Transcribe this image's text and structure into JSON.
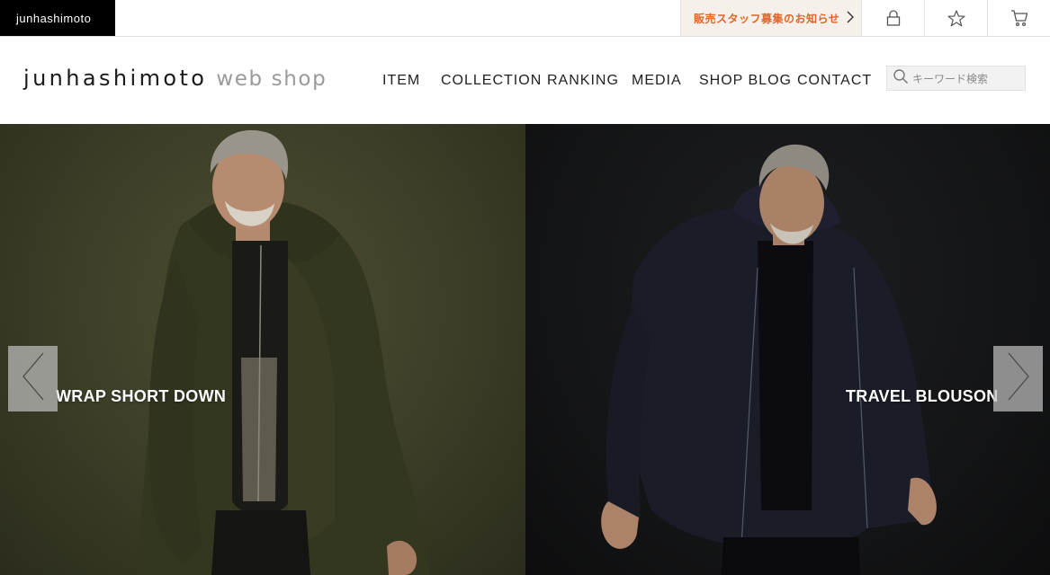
{
  "topbar": {
    "brand": "junhashimoto",
    "recruit": "販売スタッフ募集のお知らせ",
    "icons": [
      "chevron-right-icon",
      "lock-icon",
      "star-icon",
      "cart-icon"
    ]
  },
  "header": {
    "logo_main": "junhashimoto",
    "logo_sub": "web shop",
    "nav": [
      "ITEM",
      "COLLECTION",
      "RANKING",
      "MEDIA",
      "SHOP BLOG",
      "CONTACT"
    ],
    "search_placeholder": "キーワード検索"
  },
  "hero": {
    "slides": [
      {
        "title": "WRAP SHORT DOWN"
      },
      {
        "title": "TRAVEL BLOUSON"
      }
    ],
    "prev_icon": "chevron-left-icon",
    "next_icon": "chevron-right-icon"
  },
  "colors": {
    "accent": "#e0662d",
    "brand_bg": "#000000",
    "left_panel": "#3b3d27",
    "right_panel": "#141516"
  }
}
